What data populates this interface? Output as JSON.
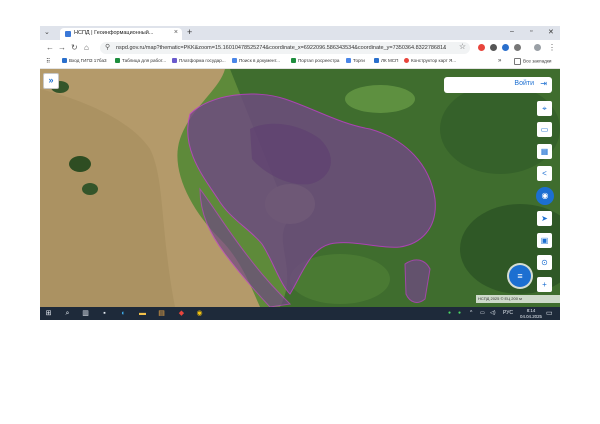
{
  "browser": {
    "tab_title": "НСПД | Геоинформационный...",
    "url": "nspd.gov.ru/map?thematic=PKK&zoom=15.16010478525274&coordinate_x=6922096.586343534&coordinate_y=7350364.832278681&the...",
    "tab_menu_icon": "chevron-down-icon",
    "window_controls": [
      "–",
      "▫",
      "✕"
    ]
  },
  "bookmarks": [
    {
      "label": "Вход ГИПЗ 17ба3",
      "color": "#2a6fcc"
    },
    {
      "label": "Таблица для работ...",
      "color": "#1e8e3e"
    },
    {
      "label": "Платформа государ...",
      "color": "#6a5acd"
    },
    {
      "label": "Поиск в документ...",
      "color": "#4a86e8"
    },
    {
      "label": "Портал росреестра",
      "color": "#1e8e3e"
    },
    {
      "label": "Торги",
      "color": "#4a86e8"
    },
    {
      "label": "ЛК МСП",
      "color": "#2a6fcc"
    },
    {
      "label": "Конструктор карт Я...",
      "color": "#e8453c"
    }
  ],
  "bookmarks_more": "»",
  "bookmarks_all": "Все закладки",
  "map": {
    "login_label": "Войти",
    "side_toggle": "»",
    "scale_text": "НСПД 2025 © ЕЦ   200 м",
    "tools": [
      "map-pin-icon",
      "layers-icon",
      "measure-icon",
      "share-icon",
      "chat-icon",
      "locate-icon",
      "image-icon",
      "search-icon",
      "plus-icon"
    ]
  },
  "taskbar": {
    "tray_lang": "РУС",
    "clock_time": "8:14",
    "clock_date": "04.04.2025"
  }
}
